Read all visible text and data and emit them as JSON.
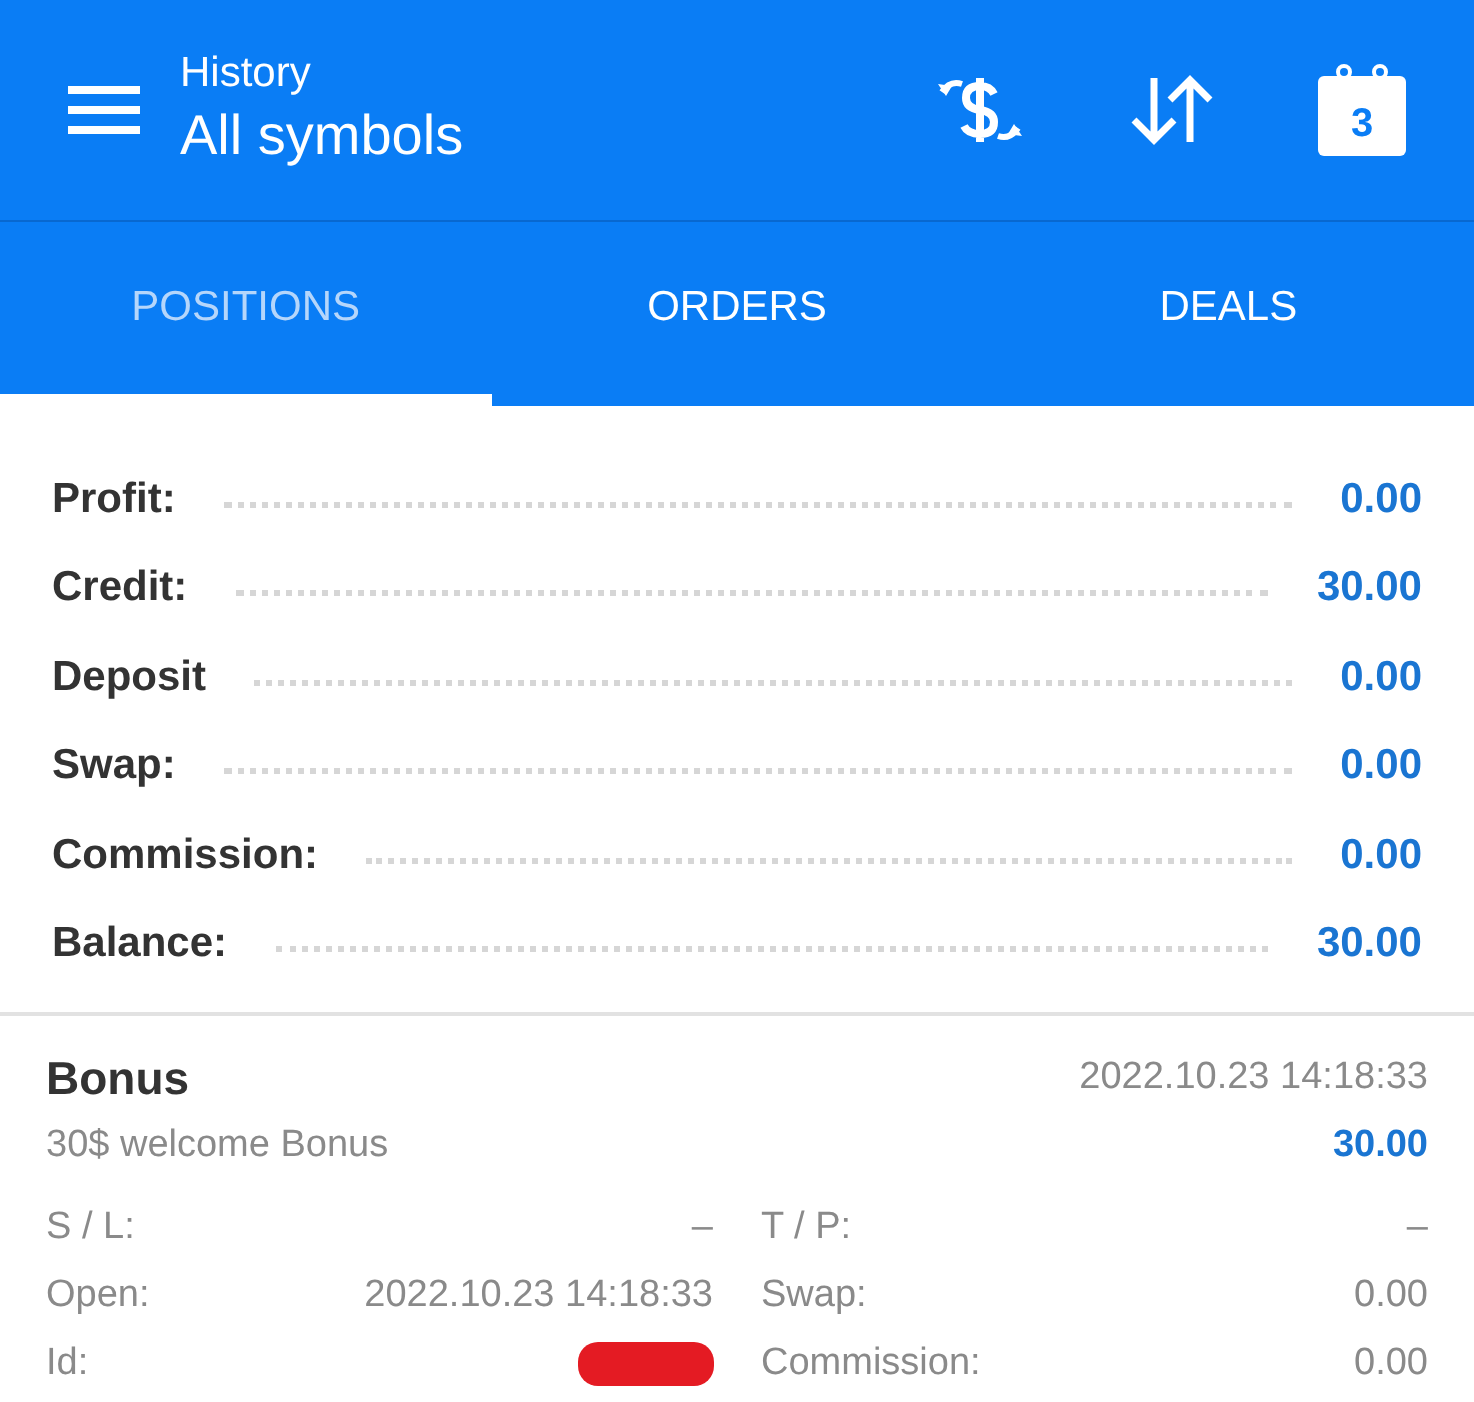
{
  "header": {
    "subtitle": "History",
    "title": "All symbols",
    "calendar_day": "3"
  },
  "tabs": [
    {
      "label": "POSITIONS",
      "selected": true
    },
    {
      "label": "ORDERS",
      "selected": false
    },
    {
      "label": "DEALS",
      "selected": false
    }
  ],
  "summary": [
    {
      "label": "Profit:",
      "value": "0.00"
    },
    {
      "label": "Credit:",
      "value": "30.00"
    },
    {
      "label": "Deposit",
      "value": "0.00"
    },
    {
      "label": "Swap:",
      "value": "0.00"
    },
    {
      "label": "Commission:",
      "value": "0.00"
    },
    {
      "label": "Balance:",
      "value": "30.00"
    }
  ],
  "deal": {
    "title": "Bonus",
    "time": "2022.10.23 14:18:33",
    "comment": "30$ welcome Bonus",
    "amount": "30.00",
    "details": [
      {
        "label": "S / L:",
        "value": "–"
      },
      {
        "label": "T / P:",
        "value": "–"
      },
      {
        "label": "Open:",
        "value": "2022.10.23 14:18:33"
      },
      {
        "label": "Swap:",
        "value": "0.00"
      },
      {
        "label": "Id:",
        "kind": "redacted"
      },
      {
        "label": "Commission:",
        "value": "0.00"
      }
    ]
  }
}
